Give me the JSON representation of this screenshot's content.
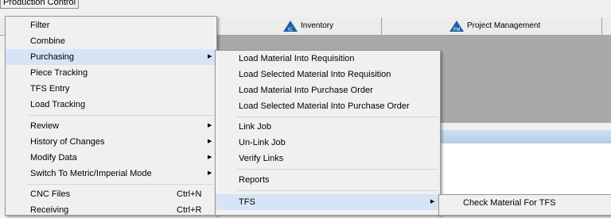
{
  "menubar": {
    "production_control": "Production Control"
  },
  "toolbar": {
    "inventory_label": "Inventory",
    "inventory_icon_text": "IC",
    "project_management_label": "Project Management",
    "project_management_icon_text": "PM"
  },
  "menu_main": {
    "items": [
      {
        "label": "Filter"
      },
      {
        "label": "Combine"
      },
      {
        "label": "Purchasing"
      },
      {
        "label": "Piece Tracking"
      },
      {
        "label": "TFS Entry"
      },
      {
        "label": "Load Tracking"
      },
      {
        "label": "Review"
      },
      {
        "label": "History of Changes"
      },
      {
        "label": "Modify Data"
      },
      {
        "label": "Switch To Metric/Imperial Mode"
      },
      {
        "label": "CNC Files",
        "shortcut": "Ctrl+N"
      },
      {
        "label": "Receiving",
        "shortcut": "Ctrl+R"
      }
    ]
  },
  "menu_purchasing": {
    "items": [
      {
        "label": "Load Material Into Requisition"
      },
      {
        "label": "Load Selected Material Into Requisition"
      },
      {
        "label": "Load Material Into Purchase Order"
      },
      {
        "label": "Load Selected Material Into Purchase Order"
      },
      {
        "label": "Link Job"
      },
      {
        "label": "Un-Link Job"
      },
      {
        "label": "Verify Links"
      },
      {
        "label": "Reports"
      },
      {
        "label": "TFS"
      }
    ]
  },
  "menu_tfs": {
    "items": [
      {
        "label": "Check Material For TFS"
      }
    ]
  },
  "colors": {
    "menu_bg": "#f0f0f0",
    "highlight": "#d6e4f5",
    "icon_blue": "#1a5fa8"
  }
}
